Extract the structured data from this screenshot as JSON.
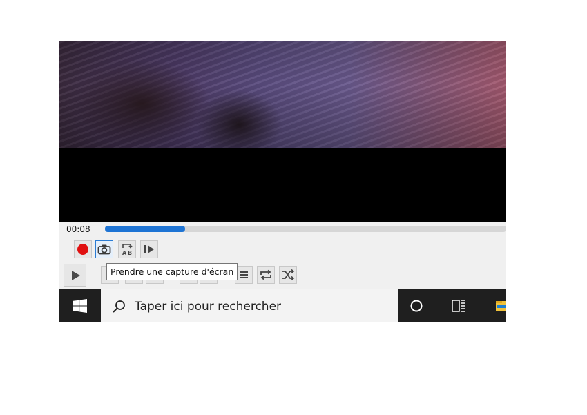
{
  "player": {
    "elapsed_time": "00:08",
    "seek_progress": 0.2,
    "tooltip": "Prendre une capture d'écran",
    "icons": {
      "record": "record-icon",
      "snapshot": "camera-icon",
      "loop_ab": "loop-ab-icon",
      "frame_step": "frame-step-icon",
      "play": "play-icon",
      "loop": "loop-icon",
      "shuffle": "shuffle-icon"
    },
    "colors": {
      "seek_fill": "#1e74d4",
      "record": "#e01010"
    }
  },
  "taskbar": {
    "search_placeholder": "Taper ici pour rechercher",
    "icons": [
      "windows-logo-icon",
      "search-icon",
      "cortana-icon",
      "task-view-icon",
      "file-explorer-icon"
    ]
  }
}
